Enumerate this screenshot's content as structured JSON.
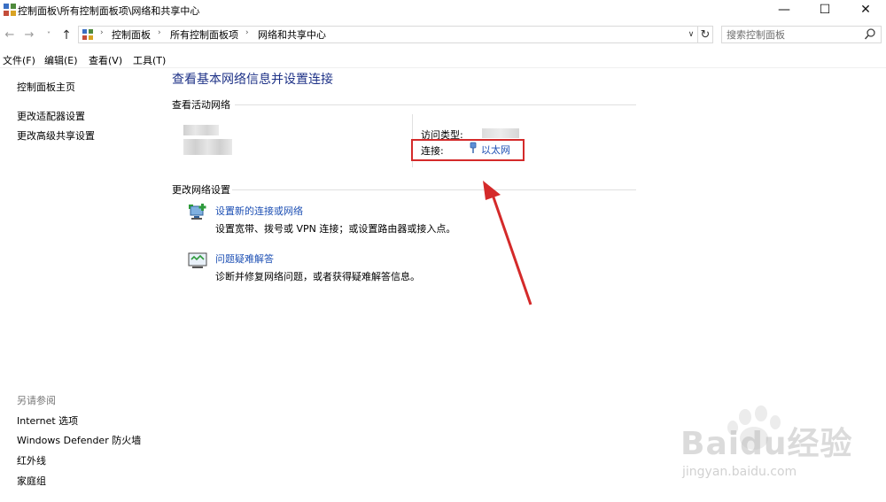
{
  "window": {
    "title": "控制面板\\所有控制面板项\\网络和共享中心",
    "minimize_glyph": "—",
    "maximize_glyph": "☐",
    "close_glyph": "✕"
  },
  "nav": {
    "back_glyph": "←",
    "forward_glyph": "→",
    "recent_glyph": "˅",
    "up_glyph": "↑",
    "refresh_glyph": "↻",
    "dropdown_glyph": "∨"
  },
  "breadcrumbs": [
    "控制面板",
    "所有控制面板项",
    "网络和共享中心"
  ],
  "breadcrumb_sep": "›",
  "search": {
    "placeholder": "搜索控制面板"
  },
  "menu": {
    "file": "文件(F)",
    "edit": "编辑(E)",
    "view": "查看(V)",
    "tools": "工具(T)"
  },
  "sidebar": {
    "home": "控制面板主页",
    "adapter": "更改适配器设置",
    "advanced_sharing": "更改高级共享设置",
    "see_also": "另请参阅",
    "see_also_links": [
      "Internet 选项",
      "Windows Defender 防火墙",
      "红外线",
      "家庭组"
    ]
  },
  "main": {
    "title": "查看基本网络信息并设置连接",
    "active_networks_header": "查看活动网络",
    "access_type_label": "访问类型:",
    "connections_label": "连接:",
    "connection_name": "以太网",
    "change_settings_header": "更改网络设置",
    "tasks": [
      {
        "title": "设置新的连接或网络",
        "desc": "设置宽带、拨号或 VPN 连接；或设置路由器或接入点。"
      },
      {
        "title": "问题疑难解答",
        "desc": "诊断并修复网络问题，或者获得疑难解答信息。"
      }
    ]
  },
  "watermark": {
    "text": "Baidu经验",
    "sub": "jingyan.baidu.com"
  },
  "colors": {
    "title_blue": "#1e3287",
    "link_blue": "#1e50b4",
    "annotation_red": "#d42a2a"
  }
}
